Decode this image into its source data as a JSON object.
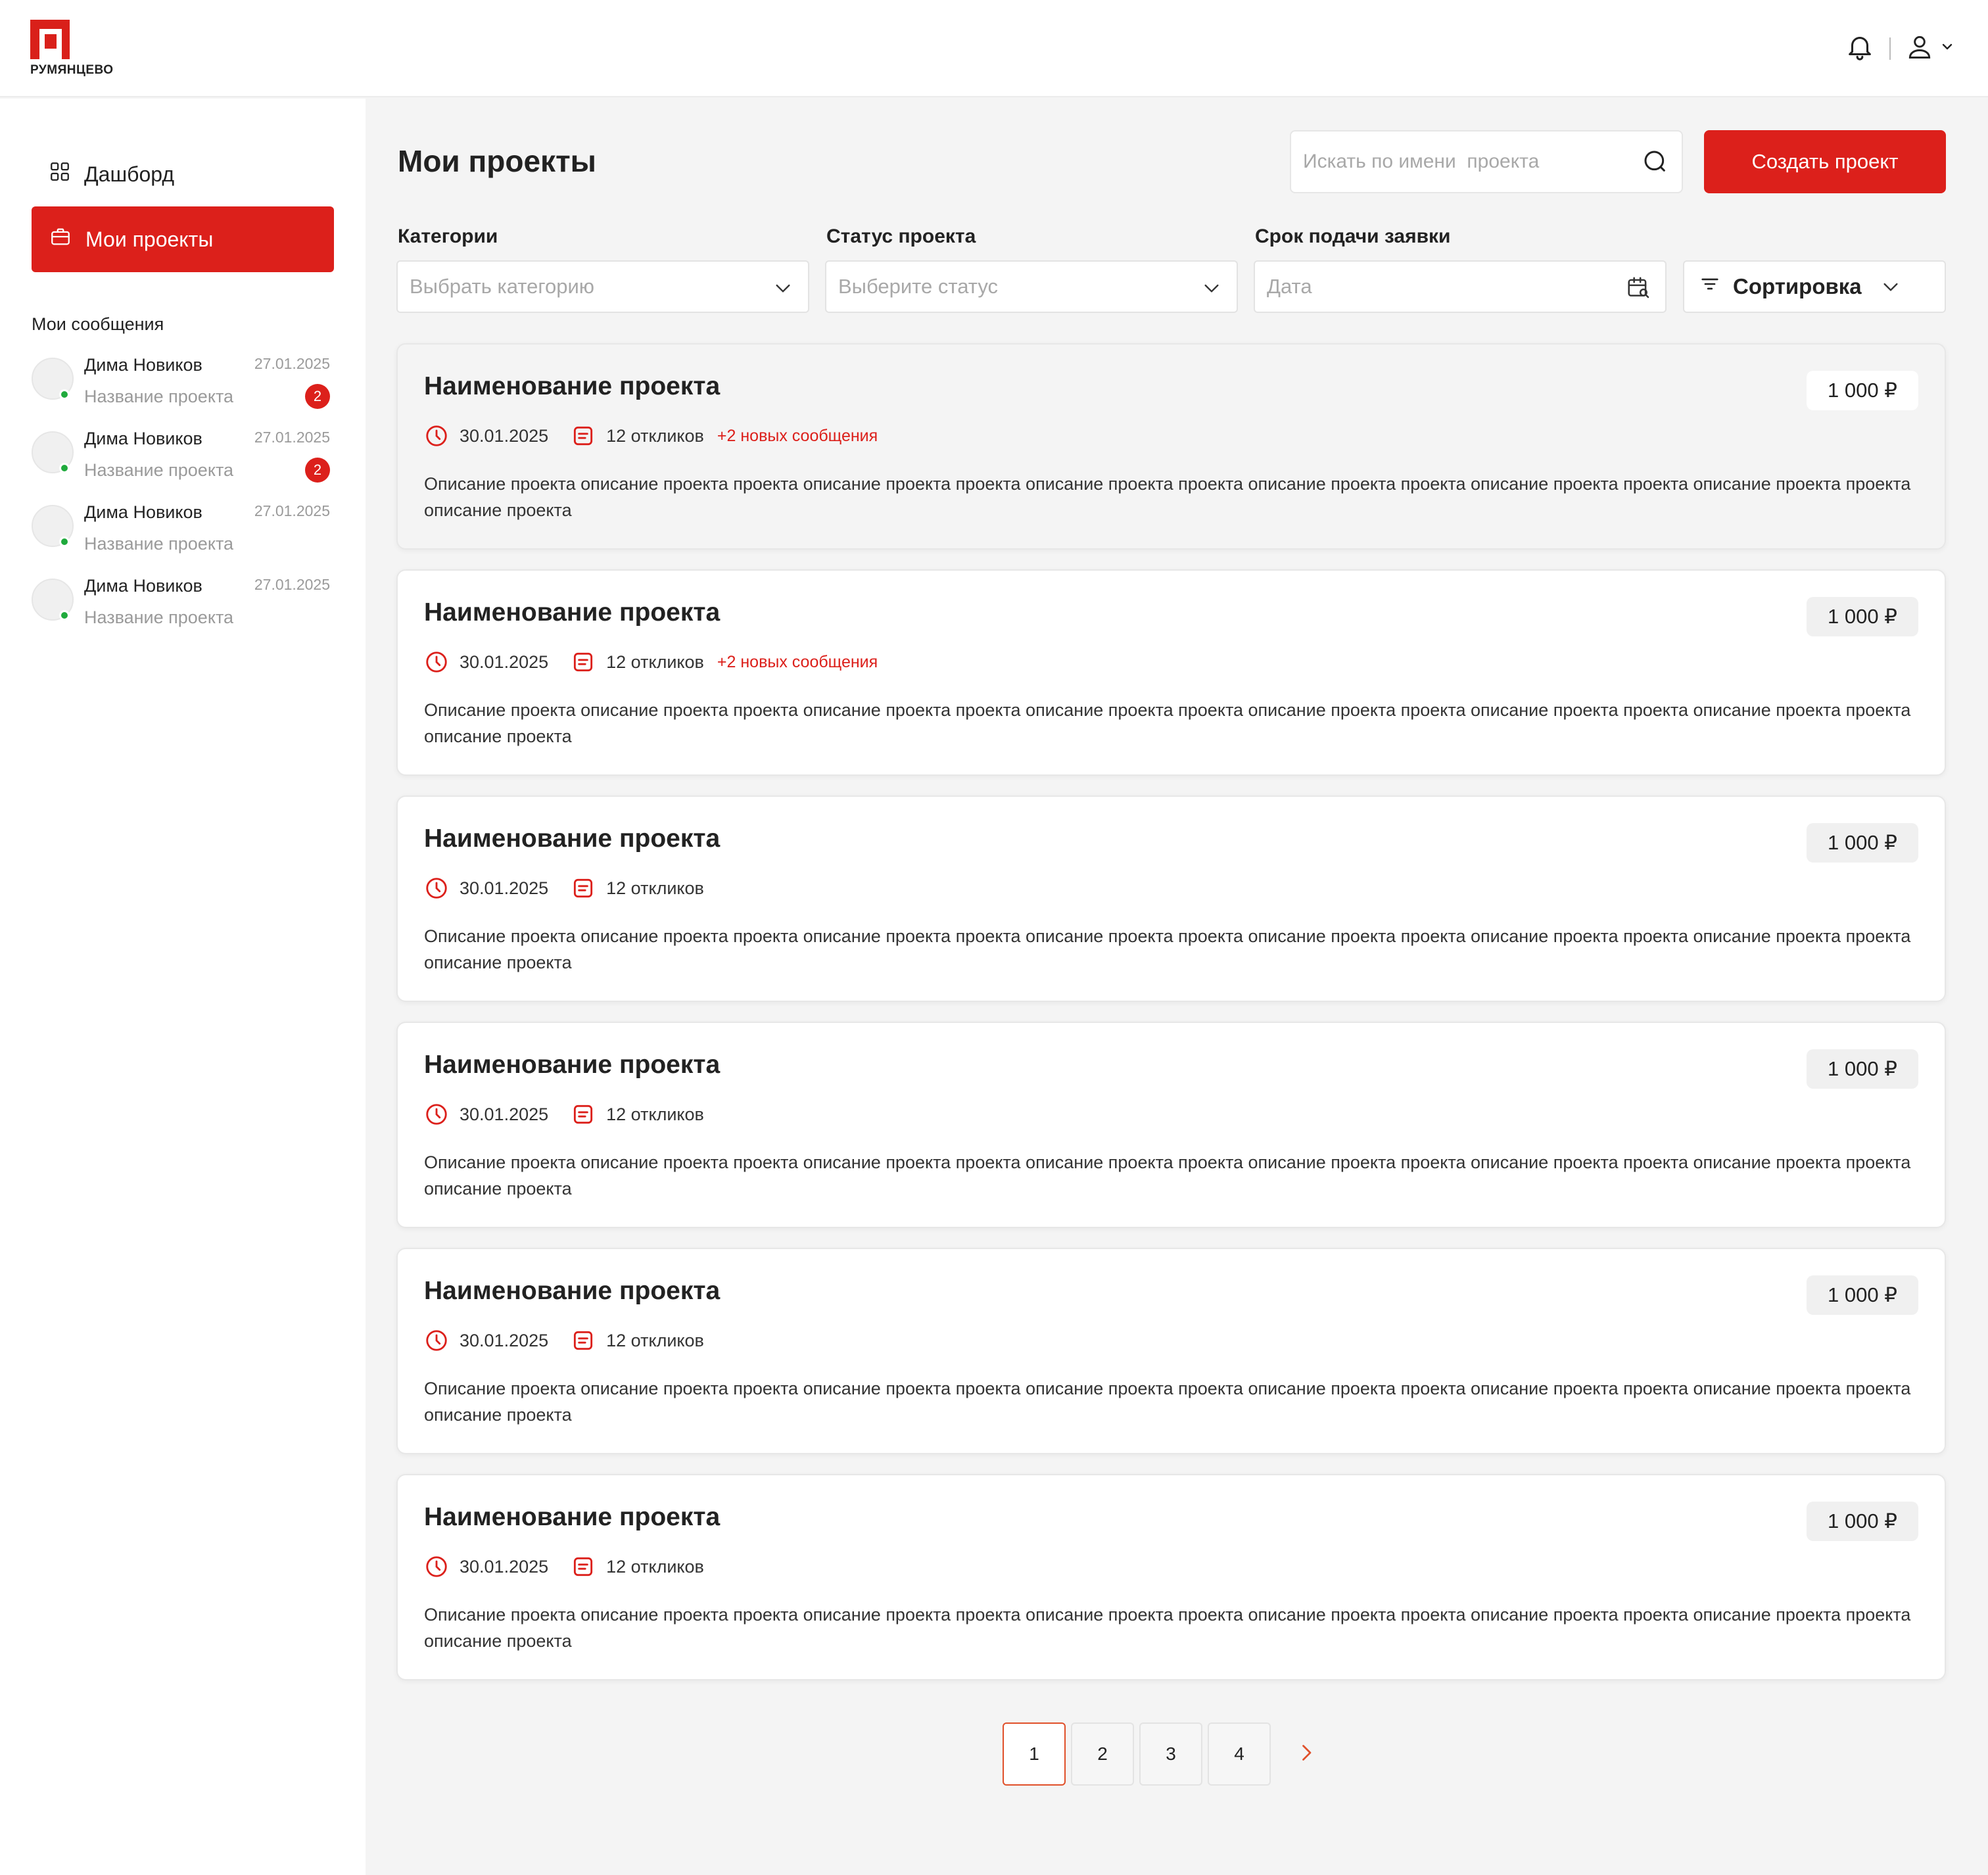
{
  "header": {
    "logo_text": "РУМЯНЦЕВО"
  },
  "colors": {
    "accent": "#dc201b",
    "online": "#1faa3c"
  },
  "sidebar": {
    "nav": [
      {
        "label": "Дашборд",
        "icon": "grid-icon"
      },
      {
        "label": "Мои проекты",
        "icon": "briefcase-icon"
      }
    ],
    "messages_title": "Мои сообщения",
    "messages": [
      {
        "name": "Дима Новиков",
        "project": "Название проекта",
        "date": "27.01.2025",
        "badge": "2"
      },
      {
        "name": "Дима Новиков",
        "project": "Название проекта",
        "date": "27.01.2025",
        "badge": "2"
      },
      {
        "name": "Дима Новиков",
        "project": "Название проекта",
        "date": "27.01.2025",
        "badge": ""
      },
      {
        "name": "Дима Новиков",
        "project": "Название проекта",
        "date": "27.01.2025",
        "badge": ""
      }
    ]
  },
  "main": {
    "title": "Мои проекты",
    "search_placeholder": "Искать по имени  проекта",
    "create_button": "Создать проект",
    "filters": {
      "category_label": "Категории",
      "category_placeholder": "Выбрать категорию",
      "status_label": "Статус проекта",
      "status_placeholder": "Выберите статус",
      "deadline_label": "Срок подачи заявки",
      "deadline_placeholder": "Дата",
      "sort_label": "Сортировка"
    },
    "projects": [
      {
        "title": "Наименование проекта",
        "price": "1 000 ₽",
        "date": "30.01.2025",
        "responses": "12 откликов",
        "new_messages": "+2 новых сообщения",
        "description": "Описание проекта описание проекта проекта описание проекта проекта описание проекта проекта описание проекта проекта описание проекта проекта описание проекта проекта описание проекта"
      },
      {
        "title": "Наименование проекта",
        "price": "1 000 ₽",
        "date": "30.01.2025",
        "responses": "12 откликов",
        "new_messages": "+2 новых сообщения",
        "description": "Описание проекта описание проекта проекта описание проекта проекта описание проекта проекта описание проекта проекта описание проекта проекта описание проекта проекта описание проекта"
      },
      {
        "title": "Наименование проекта",
        "price": "1 000 ₽",
        "date": "30.01.2025",
        "responses": "12 откликов",
        "new_messages": "",
        "description": "Описание проекта описание проекта проекта описание проекта проекта описание проекта проекта описание проекта проекта описание проекта проекта описание проекта проекта описание проекта"
      },
      {
        "title": "Наименование проекта",
        "price": "1 000 ₽",
        "date": "30.01.2025",
        "responses": "12 откликов",
        "new_messages": "",
        "description": "Описание проекта описание проекта проекта описание проекта проекта описание проекта проекта описание проекта проекта описание проекта проекта описание проекта проекта описание проекта"
      },
      {
        "title": "Наименование проекта",
        "price": "1 000 ₽",
        "date": "30.01.2025",
        "responses": "12 откликов",
        "new_messages": "",
        "description": "Описание проекта описание проекта проекта описание проекта проекта описание проекта проекта описание проекта проекта описание проекта проекта описание проекта проекта описание проекта"
      },
      {
        "title": "Наименование проекта",
        "price": "1 000 ₽",
        "date": "30.01.2025",
        "responses": "12 откликов",
        "new_messages": "",
        "description": "Описание проекта описание проекта проекта описание проекта проекта описание проекта проекта описание проекта проекта описание проекта проекта описание проекта проекта описание проекта"
      }
    ],
    "pagination": {
      "pages": [
        "1",
        "2",
        "3",
        "4"
      ],
      "current": "1"
    }
  }
}
